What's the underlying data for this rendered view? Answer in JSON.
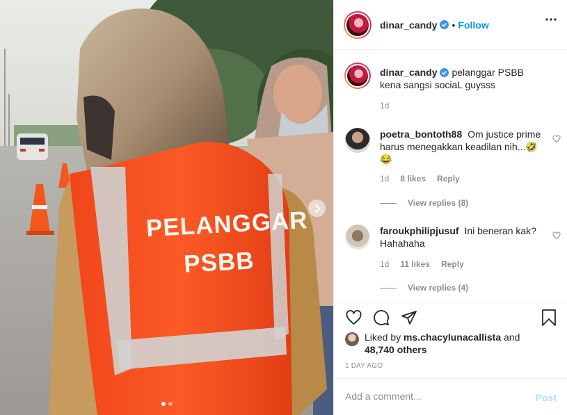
{
  "post": {
    "image_text": {
      "line1": "PELANGGAR",
      "line2": "PSBB"
    },
    "carousel": {
      "current": 1,
      "total": 2
    }
  },
  "header": {
    "username": "dinar_candy",
    "separator": "•",
    "follow_label": "Follow"
  },
  "caption": {
    "username": "dinar_candy",
    "text": "pelanggar PSBB kena sangsi sociaL guysss",
    "age": "1d"
  },
  "comments": [
    {
      "username": "poetra_bontoth88",
      "text": "Om justice prime harus menegakkan keadilan nih...🤣😂",
      "age": "1d",
      "likes": "8 likes",
      "reply_label": "Reply",
      "view_replies": "View replies (8)"
    },
    {
      "username": "faroukphilipjusuf",
      "text": "Ini beneran kak? Hahahaha",
      "age": "1d",
      "likes": "11 likes",
      "reply_label": "Reply",
      "view_replies": "View replies (4)"
    }
  ],
  "likes": {
    "prefix": "Liked by",
    "user": "ms.chacylunacallista",
    "and": "and",
    "others": "48,740 others"
  },
  "timestamp": "1 DAY AGO",
  "comment_box": {
    "placeholder": "Add a comment...",
    "post_label": "Post"
  },
  "icons": [
    "verified-badge-icon",
    "more-options-icon",
    "heart-icon",
    "comment-icon",
    "share-icon",
    "save-icon",
    "chevron-right-icon"
  ],
  "colors": {
    "link": "#0095f6",
    "post_disabled": "#b2dffc",
    "muted": "#8e8e8e",
    "vest": "#f24a1c"
  }
}
